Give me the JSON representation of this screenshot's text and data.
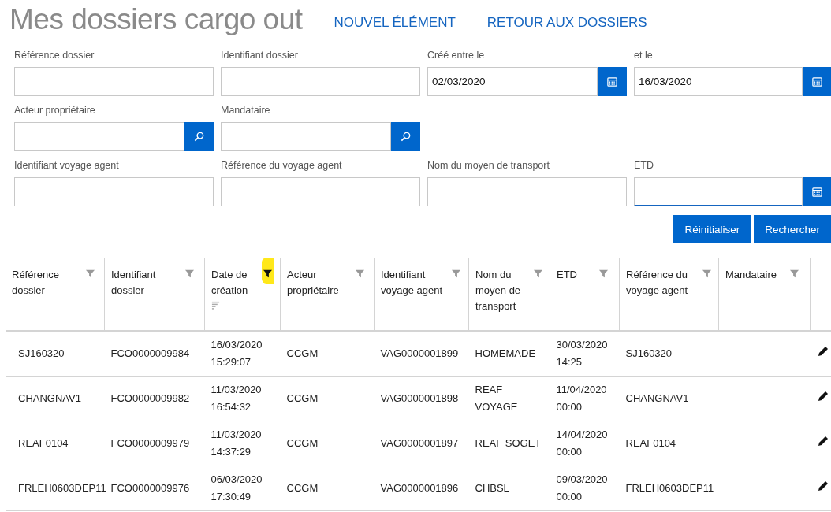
{
  "header": {
    "title": "Mes dossiers cargo out",
    "links": [
      "NOUVEL ÉLÉMENT",
      "RETOUR AUX DOSSIERS"
    ]
  },
  "filters": [
    {
      "label": "Référence dossier",
      "kind": "text",
      "focused": false
    },
    {
      "label": "Identifiant dossier",
      "kind": "text",
      "focused": false
    },
    {
      "label": "Créé entre le",
      "kind": "date",
      "value": "02/03/2020",
      "focused": false
    },
    {
      "label": "et le",
      "kind": "date",
      "value": "16/03/2020",
      "focused": false
    },
    {
      "label": "Acteur propriétaire",
      "kind": "search",
      "focused": false
    },
    {
      "label": "Mandataire",
      "kind": "search",
      "focused": false
    },
    {
      "kind": "empty"
    },
    {
      "kind": "empty"
    },
    {
      "label": "Identifiant voyage agent",
      "kind": "text",
      "focused": false
    },
    {
      "label": "Référence du voyage agent",
      "kind": "text",
      "focused": false
    },
    {
      "label": "Nom du moyen de transport",
      "kind": "text",
      "focused": false
    },
    {
      "label": "ETD",
      "kind": "date",
      "focused": true
    }
  ],
  "actions": [
    "Réinitialiser",
    "Rechercher"
  ],
  "table": {
    "columns": [
      {
        "label": "Référence dossier",
        "filter_active": false,
        "sorted": false
      },
      {
        "label": "Identifiant dossier",
        "filter_active": false,
        "sorted": false
      },
      {
        "label": "Date de création",
        "filter_active": true,
        "sorted": true
      },
      {
        "label": "Acteur propriétaire",
        "filter_active": false,
        "sorted": false
      },
      {
        "label": "Identifiant voyage agent",
        "filter_active": false,
        "sorted": false
      },
      {
        "label": "Nom du moyen de transport",
        "filter_active": false,
        "sorted": false
      },
      {
        "label": "ETD",
        "filter_active": false,
        "sorted": false
      },
      {
        "label": "Référence du voyage agent",
        "filter_active": false,
        "sorted": false
      },
      {
        "label": "Mandataire",
        "filter_active": false,
        "sorted": false
      }
    ],
    "rows": [
      [
        "SJ160320",
        "FCO0000009984",
        "16/03/2020 15:29:07",
        "CCGM",
        "VAG0000001899",
        "HOMEMADE",
        "30/03/2020 14:25",
        "SJ160320",
        ""
      ],
      [
        "CHANGNAV1",
        "FCO0000009982",
        "11/03/2020 16:54:32",
        "CCGM",
        "VAG0000001898",
        "REAF VOYAGE",
        "11/04/2020 00:00",
        "CHANGNAV1",
        ""
      ],
      [
        "REAF0104",
        "FCO0000009979",
        "11/03/2020 14:37:29",
        "CCGM",
        "VAG0000001897",
        "REAF SOGET",
        "14/04/2020 00:00",
        "REAF0104",
        ""
      ],
      [
        "FRLEH0603DEP11",
        "FCO0000009976",
        "06/03/2020 17:30:49",
        "CCGM",
        "VAG0000001896",
        "CHBSL",
        "09/03/2020 00:00",
        "FRLEH0603DEP11",
        ""
      ]
    ]
  }
}
